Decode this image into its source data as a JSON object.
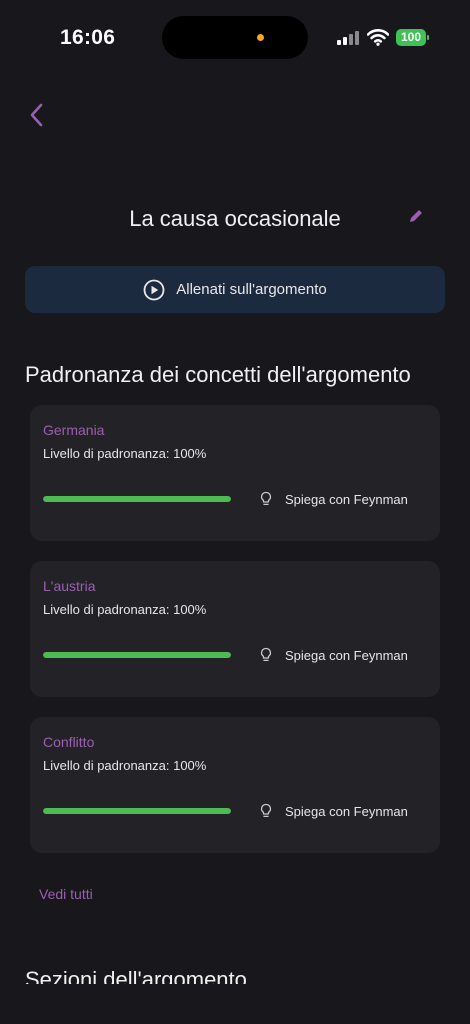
{
  "status_bar": {
    "time": "16:06",
    "battery": "100",
    "battery_color": "#3fc255",
    "icons": [
      "signal-icon",
      "wifi-icon",
      "battery-icon"
    ]
  },
  "header": {
    "back_icon": "chevron-left-icon",
    "title": "La causa occasionale",
    "edit_icon": "pencil-icon"
  },
  "train_button": {
    "label": "Allenati sull'argomento",
    "icon": "play-circle-icon"
  },
  "mastery": {
    "title": "Padronanza dei concetti dell'argomento",
    "concepts": [
      {
        "name": "Germania",
        "level_text": "Livello di padronanza: 100%",
        "progress": 1.0,
        "action": "Spiega con Feynman"
      },
      {
        "name": "L'austria",
        "level_text": "Livello di padronanza: 100%",
        "progress": 1.0,
        "action": "Spiega con Feynman"
      },
      {
        "name": "Conflitto",
        "level_text": "Livello di padronanza: 100%",
        "progress": 1.0,
        "action": "Spiega con Feynman"
      }
    ],
    "see_all": "Vedi tutti"
  },
  "sections": {
    "title": "Sezioni dell'argomento"
  },
  "colors": {
    "accent": "#9b5fb0",
    "background": "#18171c",
    "card": "#232227",
    "button": "#1c2a3f",
    "progress": "#4dbb52"
  }
}
